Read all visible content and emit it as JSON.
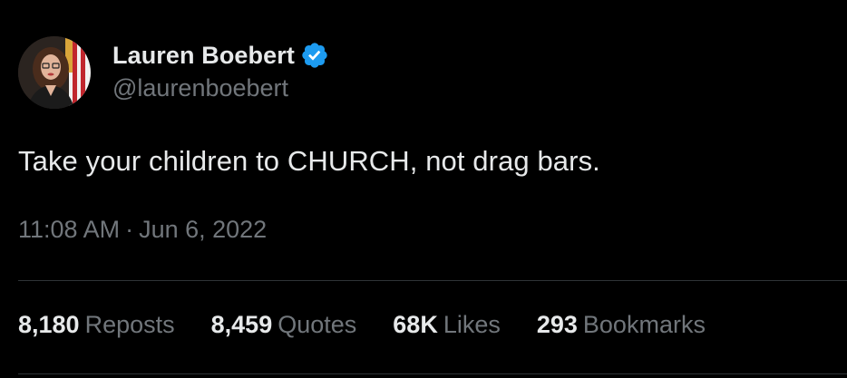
{
  "author": {
    "display_name": "Lauren Boebert",
    "handle": "@laurenboebert",
    "verified": true,
    "avatar_icon": "profile-photo"
  },
  "tweet": {
    "text": "Take your children to CHURCH, not drag bars.",
    "time": "11:08 AM",
    "separator": "·",
    "date": "Jun 6, 2022"
  },
  "stats": [
    {
      "value": "8,180",
      "label": "Reposts"
    },
    {
      "value": "8,459",
      "label": "Quotes"
    },
    {
      "value": "68K",
      "label": "Likes"
    },
    {
      "value": "293",
      "label": "Bookmarks"
    }
  ],
  "colors": {
    "background": "#000000",
    "primary_text": "#e7e9ea",
    "secondary_text": "#71767b",
    "verified_blue": "#1d9bf0",
    "divider": "#2f3336"
  }
}
